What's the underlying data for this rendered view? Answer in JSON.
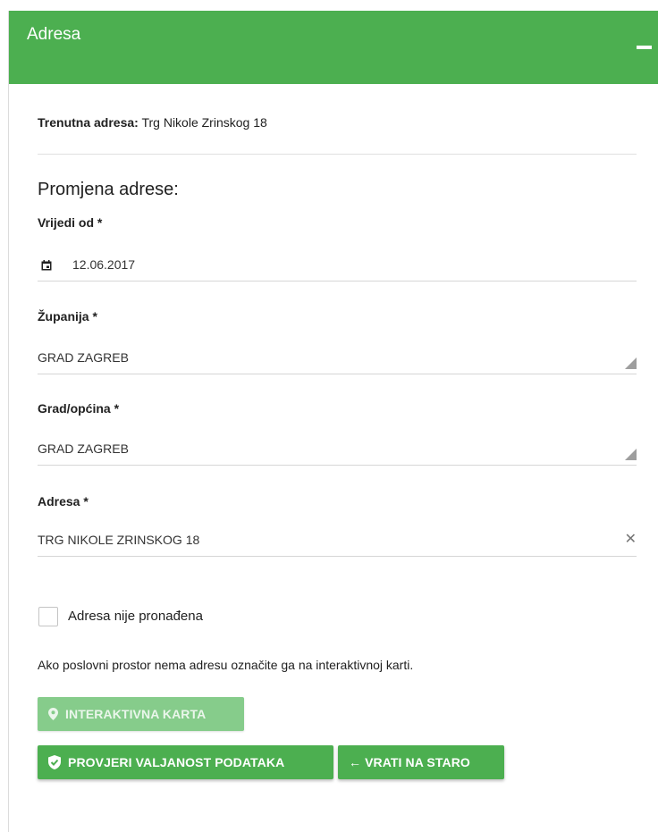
{
  "header": {
    "title": "Adresa"
  },
  "current_address": {
    "label": "Trenutna adresa:",
    "value": "Trg Nikole Zrinskog 18"
  },
  "change_section": {
    "title": "Promjena adrese:"
  },
  "fields": {
    "valid_from": {
      "label": "Vrijedi od *",
      "value": "12.06.2017",
      "icon": "calendar-icon"
    },
    "county": {
      "label": "Županija *",
      "value": "GRAD ZAGREB"
    },
    "city": {
      "label": "Grad/općina *",
      "value": "GRAD ZAGREB"
    },
    "address": {
      "label": "Adresa *",
      "value": "TRG NIKOLE ZRINSKOG 18",
      "clear_glyph": "✕"
    }
  },
  "address_not_found": {
    "label": "Adresa nije pronađena",
    "checked": false
  },
  "note": "Ako poslovni prostor nema adresu označite ga na interaktivnoj karti.",
  "buttons": {
    "map": {
      "label": "INTERAKTIVNA KARTA",
      "icon": "map-marker-icon"
    },
    "validate": {
      "label": "PROVJERI VALJANOST PODATAKA",
      "icon": "shield-check-icon"
    },
    "revert": {
      "label": "← VRATI NA STARO"
    }
  },
  "colors": {
    "accent": "#4caf50",
    "accent_disabled": "#86cc8b"
  }
}
